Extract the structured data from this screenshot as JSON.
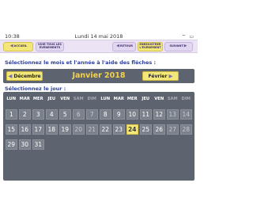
{
  "status": {
    "time": "10:38",
    "date": "Lundi 14 mai 2018",
    "icons": "⌔ ▭"
  },
  "toolbar": {
    "accueil": "ACCUEIL",
    "voir_tous": "VOIR TOUS LES ÉVÉNEMENTS",
    "retour": "RETOUR",
    "enregistrer": "ENREGISTRER L'ÉVÉNEMENT",
    "suivant": "SUIVANT"
  },
  "instructions": {
    "month": "Sélectionnez le mois et l'année à l'aide des flèches :",
    "day": "Sélectionnez le jour :"
  },
  "month_selector": {
    "prev": "Décembre",
    "current": "Janvier 2018",
    "next": "Février"
  },
  "calendar": {
    "weekdays": [
      "LUN",
      "MAR",
      "MER",
      "JEU",
      "VEN",
      "SAM",
      "DIM",
      "LUN",
      "MAR",
      "MER",
      "JEU",
      "VEN",
      "SAM",
      "DIM"
    ],
    "days": [
      [
        "1",
        "2",
        "3",
        "4",
        "5",
        "6",
        "7",
        "8",
        "9",
        "10",
        "11",
        "12",
        "13",
        "14"
      ],
      [
        "15",
        "16",
        "17",
        "18",
        "19",
        "20",
        "21",
        "22",
        "23",
        "24",
        "25",
        "26",
        "27",
        "28"
      ],
      [
        "29",
        "30",
        "31"
      ]
    ],
    "selected_day": "24",
    "colors": {
      "selected": "#f4e77a",
      "panel": "#5d6470",
      "accent": "#f3d24a"
    }
  }
}
